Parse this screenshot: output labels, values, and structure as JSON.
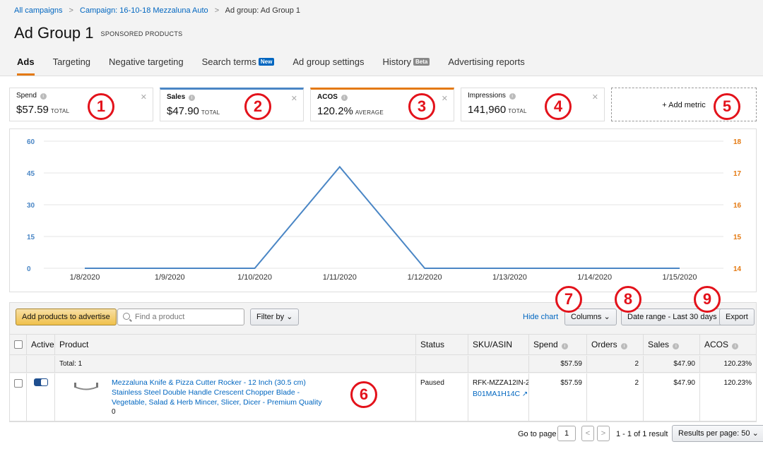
{
  "breadcrumb": {
    "all_campaigns": "All campaigns",
    "campaign": "Campaign: 16-10-18 Mezzaluna Auto",
    "ad_group": "Ad group: Ad Group 1",
    "sep": ">"
  },
  "page": {
    "title": "Ad Group 1",
    "subtitle": "SPONSORED PRODUCTS"
  },
  "tabs": [
    {
      "label": "Ads"
    },
    {
      "label": "Targeting"
    },
    {
      "label": "Negative targeting"
    },
    {
      "label": "Search terms",
      "tag": "New"
    },
    {
      "label": "Ad group settings"
    },
    {
      "label": "History",
      "tag": "Beta"
    },
    {
      "label": "Advertising reports"
    }
  ],
  "metrics": [
    {
      "label": "Spend",
      "value": "$57.59",
      "unit": "TOTAL",
      "accent": ""
    },
    {
      "label": "Sales",
      "value": "$47.90",
      "unit": "TOTAL",
      "accent": "#4a86c5"
    },
    {
      "label": "ACOS",
      "value": "120.2%",
      "unit": "AVERAGE",
      "accent": "#e47911"
    },
    {
      "label": "Impressions",
      "value": "141,960",
      "unit": "TOTAL",
      "accent": ""
    }
  ],
  "add_metric": "+ Add metric",
  "callouts": [
    "1",
    "2",
    "3",
    "4",
    "5",
    "6",
    "7",
    "8",
    "9"
  ],
  "colors": {
    "sales_line": "#4a86c5",
    "acos_axis": "#e47911",
    "callout": "#e3121b",
    "link": "#0066c0"
  },
  "chart_data": {
    "type": "line",
    "x": [
      "1/8/2020",
      "1/9/2020",
      "1/10/2020",
      "1/11/2020",
      "1/12/2020",
      "1/13/2020",
      "1/14/2020",
      "1/15/2020"
    ],
    "series": [
      {
        "values": [
          0,
          0,
          0,
          47.9,
          0,
          0,
          0,
          0
        ],
        "axis": "left"
      }
    ],
    "left_ticks": [
      "60",
      "45",
      "30",
      "15",
      "0"
    ],
    "right_ticks": [
      "18",
      "17",
      "16",
      "15",
      "14"
    ],
    "ylim": [
      0,
      60
    ],
    "ylim_right": [
      14,
      18
    ],
    "grid": true
  },
  "toolbar": {
    "add_products": "Add products to advertise",
    "search_placeholder": "Find a product",
    "filter_by": "Filter by",
    "hide_chart": "Hide chart",
    "columns": "Columns",
    "date_range": "Date range - Last 30 days",
    "export": "Export"
  },
  "table": {
    "headers": {
      "active": "Active",
      "product": "Product",
      "status": "Status",
      "sku": "SKU/ASIN",
      "spend": "Spend",
      "orders": "Orders",
      "sales": "Sales",
      "acos": "ACOS"
    },
    "total": {
      "label": "Total: 1",
      "spend": "$57.59",
      "orders": "2",
      "sales": "$47.90",
      "acos": "120.23%"
    },
    "rows": [
      {
        "product_line1": "Mezzaluna Knife & Pizza Cutter Rocker - 12 Inch (30.5 cm)",
        "product_line2": "Stainless Steel Double Handle Crescent Chopper Blade -",
        "product_line3": "Vegetable, Salad & Herb Mincer, Slicer, Dicer - Premium Quality",
        "product_sub": "0",
        "status": "Paused",
        "sku": "RFK-MZZA12IN-2(",
        "asin": "B01MA1H14C",
        "spend": "$57.59",
        "orders": "2",
        "sales": "$47.90",
        "acos": "120.23%"
      }
    ]
  },
  "pagination": {
    "go_to_page": "Go to page",
    "page_value": "1",
    "prev": "<",
    "next": ">",
    "summary": "1 - 1 of 1 result",
    "per_page": "Results per page: 50"
  }
}
